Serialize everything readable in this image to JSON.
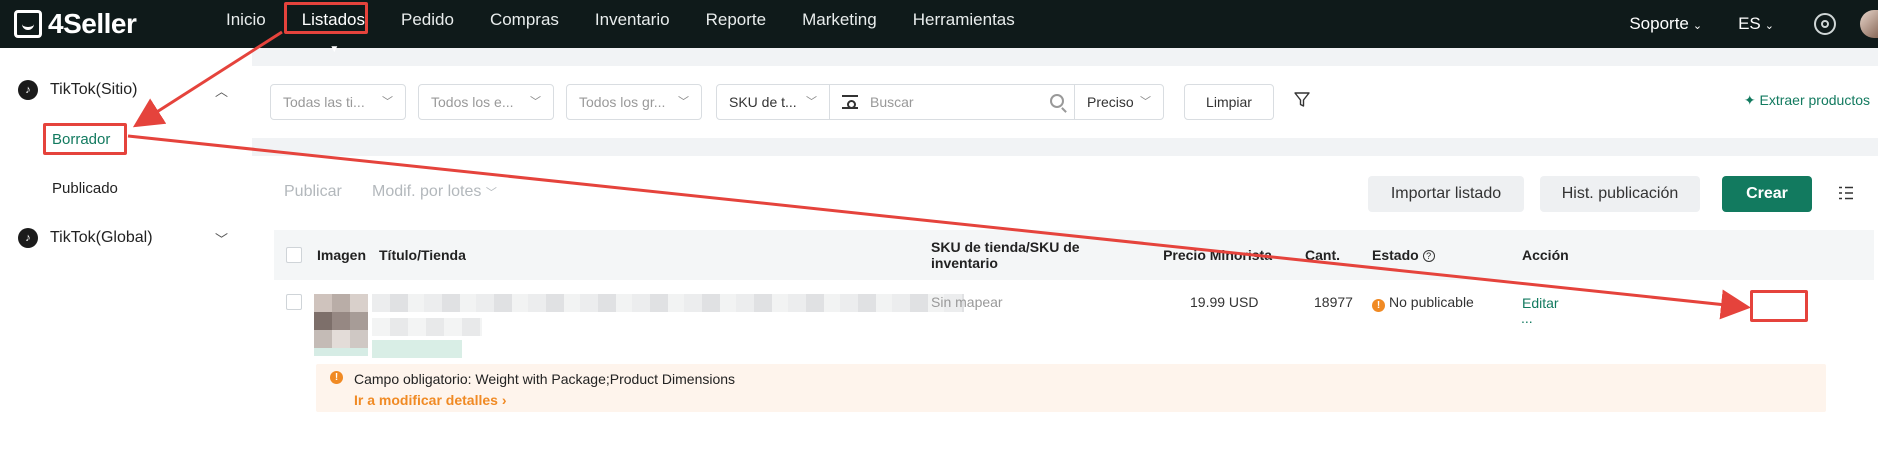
{
  "brand": {
    "name": "4Seller"
  },
  "nav": {
    "items": [
      "Inicio",
      "Listados",
      "Pedido",
      "Compras",
      "Inventario",
      "Reporte",
      "Marketing",
      "Herramientas"
    ],
    "active": "Listados"
  },
  "topright": {
    "support": "Soporte",
    "language": "ES"
  },
  "sidebar": {
    "group1": "TikTok(Sitio)",
    "items": [
      "Borrador",
      "Publicado"
    ],
    "group2": "TikTok(Global)"
  },
  "filters": {
    "store": "Todas las ti...",
    "status": "Todos los e...",
    "group": "Todos los gr...",
    "sku_type": "SKU de t...",
    "search_placeholder": "Buscar",
    "match": "Preciso",
    "clear": "Limpiar",
    "extract": "Extraer productos"
  },
  "toolbar": {
    "publish": "Publicar",
    "batch": "Modif. por lotes",
    "import": "Importar listado",
    "history": "Hist. publicación",
    "create": "Crear"
  },
  "table": {
    "headers": {
      "image": "Imagen",
      "title": "Título/Tienda",
      "sku_line1": "SKU de tienda/SKU de",
      "sku_line2": "inventario",
      "price": "Precio Minorista",
      "qty": "Cant.",
      "status": "Estado",
      "action": "Acción"
    },
    "rows": [
      {
        "sku": "Sin mapear",
        "price": "19.99 USD",
        "qty": "18977",
        "status": "No publicable",
        "action": "Editar",
        "more": "...",
        "alert_text": "Campo obligatorio: Weight with Package;Product Dimensions",
        "alert_link": "Ir a modificar detalles"
      }
    ]
  },
  "colors": {
    "accent": "#127a5f",
    "warning": "#f08a24",
    "annotation": "#e5433c",
    "topbar": "#0f1a1a"
  }
}
